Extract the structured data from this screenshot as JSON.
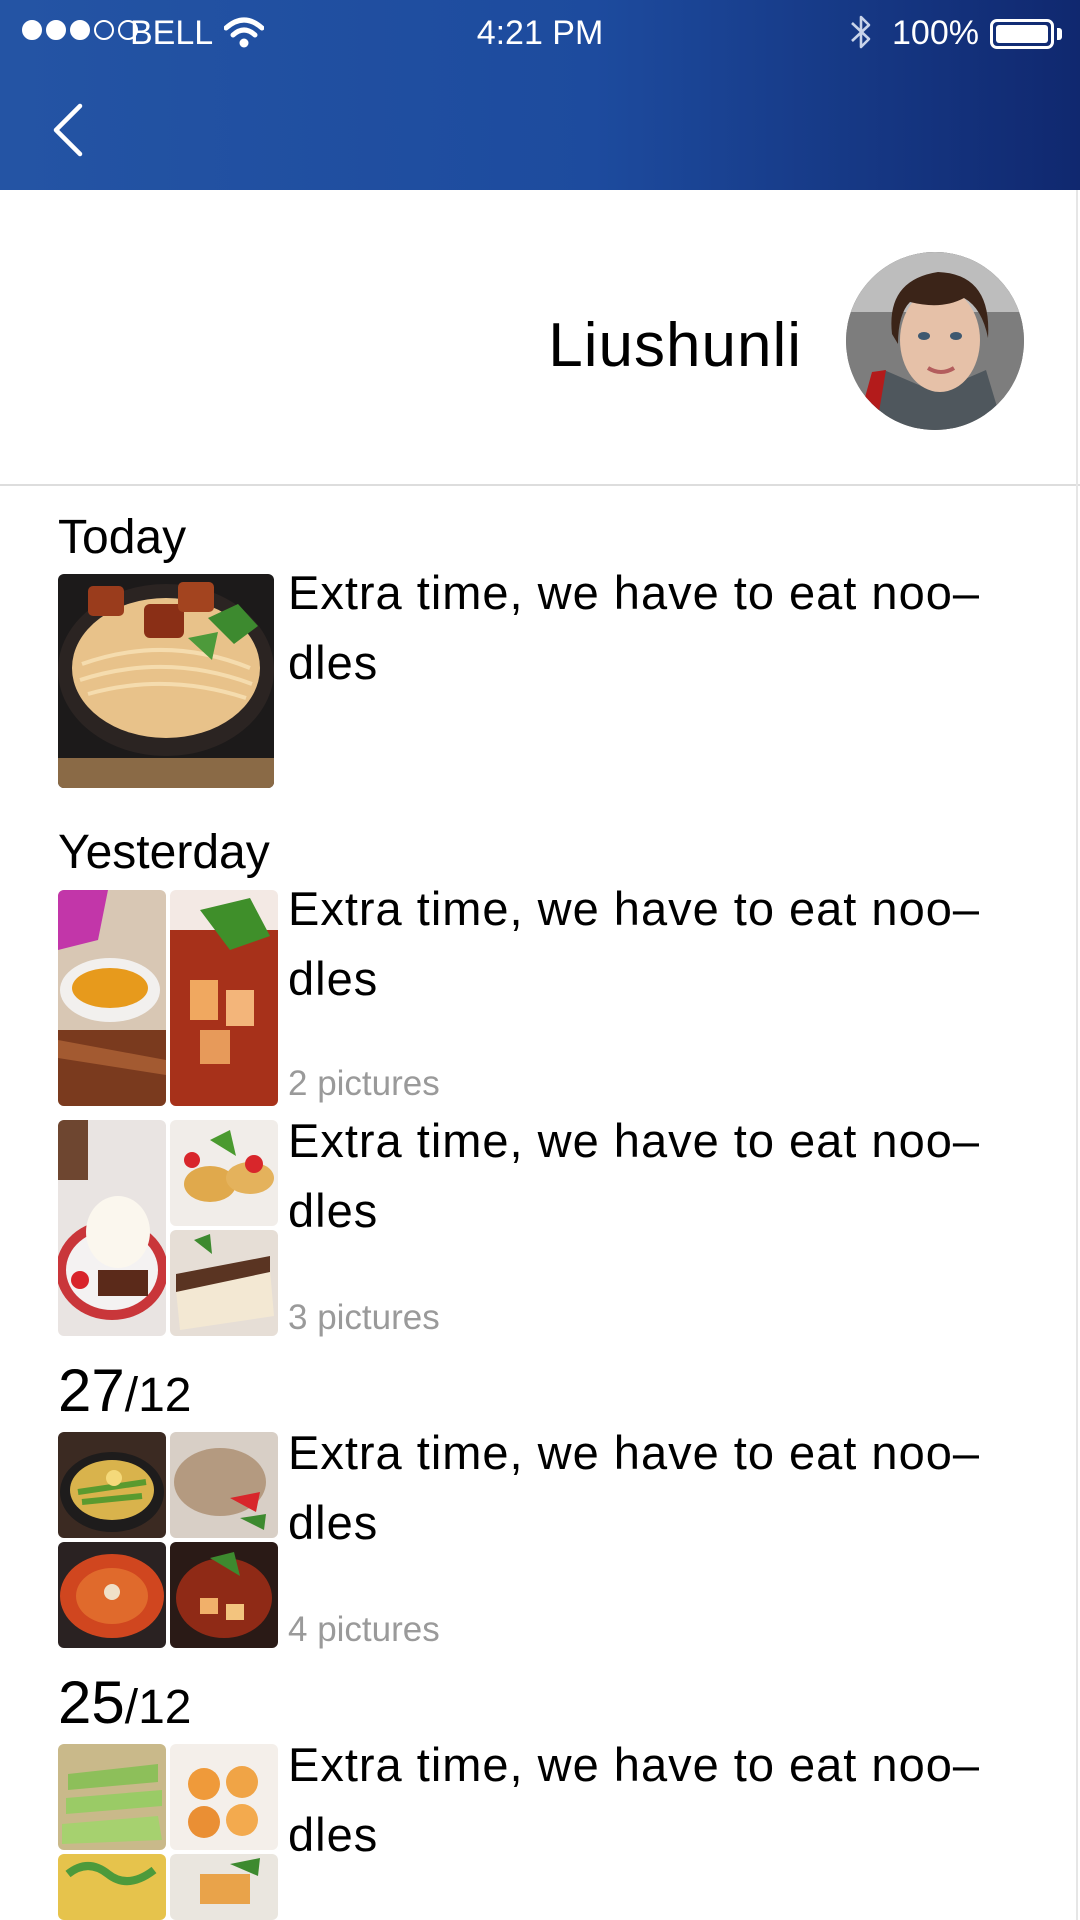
{
  "status_bar": {
    "carrier": "BELL",
    "time": "4:21 PM",
    "battery": "100%"
  },
  "profile": {
    "name": "Liushunli"
  },
  "feed": {
    "today": "Today",
    "yesterday": "Yesterday",
    "d1_day": "27",
    "d1_month": "/12",
    "d2_day": "25",
    "d2_month": "/12",
    "e1": {
      "line1": "Extra time, we have to eat noo–",
      "line2": "dles"
    },
    "e2": {
      "line1": "Extra time, we have to eat noo–",
      "line2": "dles",
      "count": "2 pictures"
    },
    "e3": {
      "line1": "Extra time, we have to eat noo–",
      "line2": "dles",
      "count": "3 pictures"
    },
    "e4": {
      "line1": "Extra time, we have to eat noo–",
      "line2": "dles",
      "count": "4 pictures"
    },
    "e5": {
      "line1": "Extra time, we have to eat noo–",
      "line2": "dles"
    }
  },
  "colors": {
    "header_start": "#2454a4",
    "header_end": "#10286f",
    "count_text": "#9a9a9a"
  },
  "icons": [
    "back-chevron-icon",
    "wifi-icon",
    "bluetooth-icon",
    "battery-icon"
  ]
}
